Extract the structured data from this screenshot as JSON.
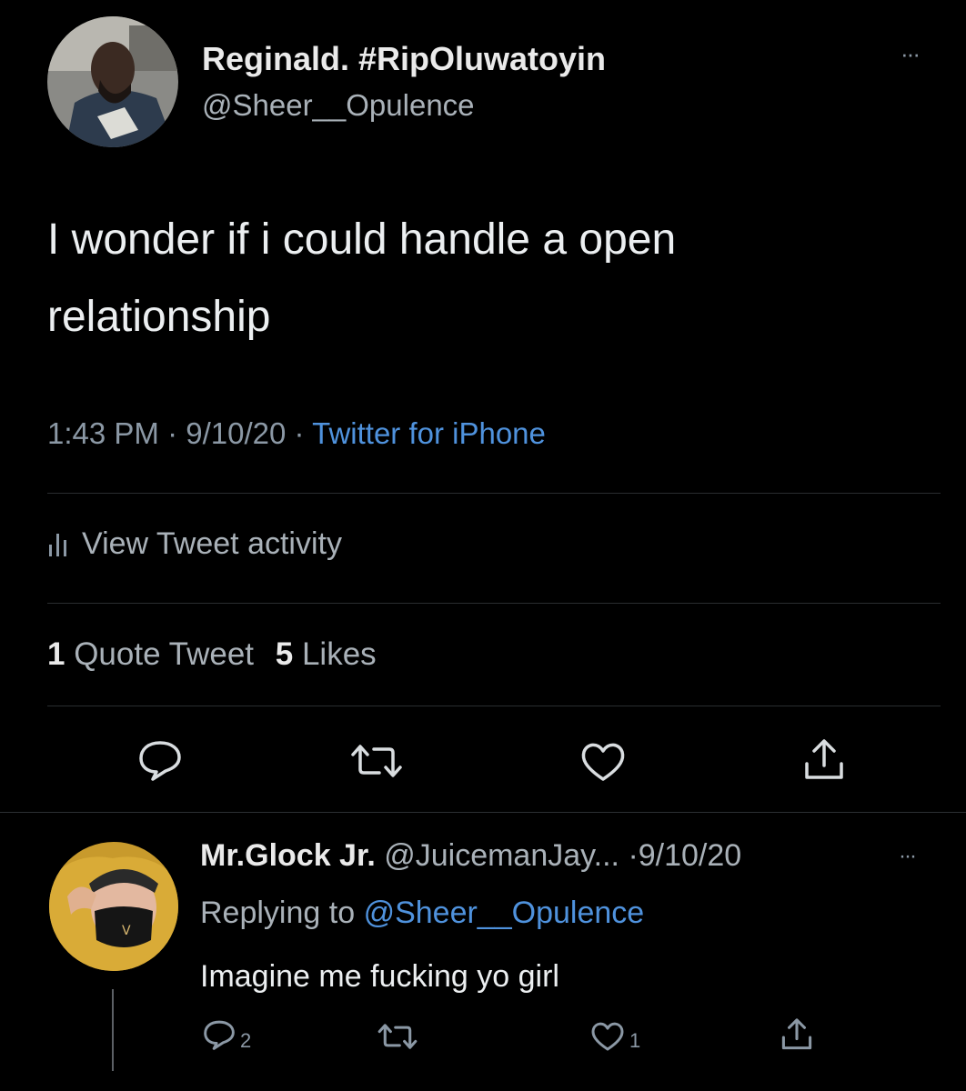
{
  "main_tweet": {
    "display_name": "Reginald. #RipOluwatoyin",
    "handle": "@Sheer__Opulence",
    "text_line1": "I wonder if i could handle a open",
    "text_line2": "relationship",
    "time": "1:43 PM",
    "date": "9/10/20",
    "separator": "·",
    "source": "Twitter for iPhone",
    "activity_label": "View Tweet activity",
    "quote_count": "1",
    "quote_label": "Quote Tweet",
    "like_count": "5",
    "like_label": "Likes",
    "more": "···"
  },
  "reply": {
    "display_name": "Mr.Glock Jr.",
    "handle": "@JuicemanJay...",
    "date": "·9/10/20",
    "replying_label": "Replying to",
    "replying_handle": "@Sheer__Opulence",
    "text": "Imagine me fucking yo girl",
    "reply_count": "2",
    "like_count": "1",
    "more": "···"
  },
  "icons": {
    "reply": "speech-bubble-icon",
    "retweet": "retweet-icon",
    "like": "heart-icon",
    "share": "share-icon",
    "activity": "bar-chart-icon"
  },
  "colors": {
    "background": "#000000",
    "link": "#4f92dd",
    "muted": "#8b98a5",
    "text": "#e7e9ea"
  }
}
